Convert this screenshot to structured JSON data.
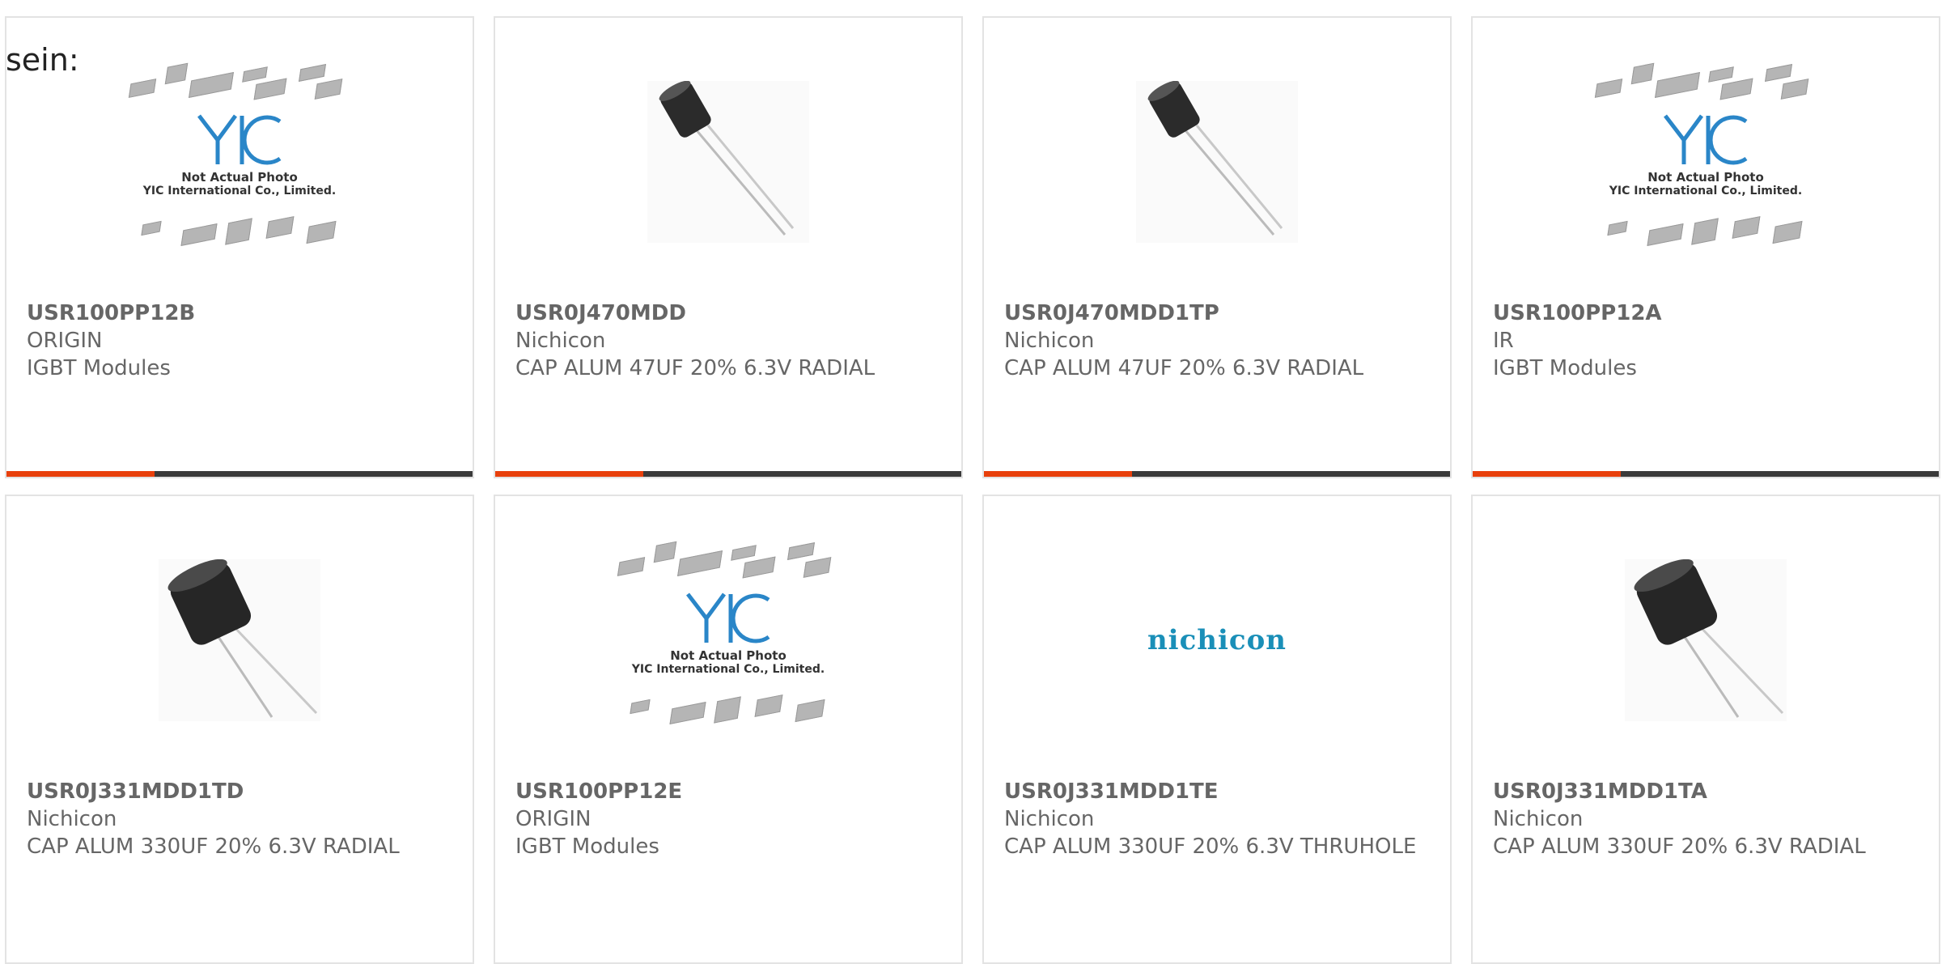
{
  "stray_text": "sein:",
  "placeholder": {
    "brand": "YIC",
    "line1": "Not Actual Photo",
    "line2": "YIC International Co., Limited."
  },
  "colors": {
    "accent": "#e8400c",
    "bar": "#3a3a3a",
    "border": "#e3e3e3",
    "nichicon_blue": "#1a8fb8"
  },
  "products": [
    {
      "part": "USR100PP12B",
      "maker": "ORIGIN",
      "desc": "IGBT Modules",
      "image": "placeholder-icon"
    },
    {
      "part": "USR0J470MDD",
      "maker": "Nichicon",
      "desc": "CAP ALUM 47UF 20% 6.3V RADIAL",
      "image": "capacitor-photo"
    },
    {
      "part": "USR0J470MDD1TP",
      "maker": "Nichicon",
      "desc": "CAP ALUM 47UF 20% 6.3V RADIAL",
      "image": "capacitor-photo"
    },
    {
      "part": "USR100PP12A",
      "maker": "IR",
      "desc": "IGBT Modules",
      "image": "placeholder-icon"
    },
    {
      "part": "USR0J331MDD1TD",
      "maker": "Nichicon",
      "desc": "CAP ALUM 330UF 20% 6.3V RADIAL",
      "image": "capacitor-photo"
    },
    {
      "part": "USR100PP12E",
      "maker": "ORIGIN",
      "desc": "IGBT Modules",
      "image": "placeholder-icon"
    },
    {
      "part": "USR0J331MDD1TE",
      "maker": "Nichicon",
      "desc": "CAP ALUM 330UF 20% 6.3V THRUHOLE",
      "image": "nichicon-logo",
      "logo_text": "nichicon"
    },
    {
      "part": "USR0J331MDD1TA",
      "maker": "Nichicon",
      "desc": "CAP ALUM 330UF 20% 6.3V RADIAL",
      "image": "capacitor-photo"
    }
  ]
}
